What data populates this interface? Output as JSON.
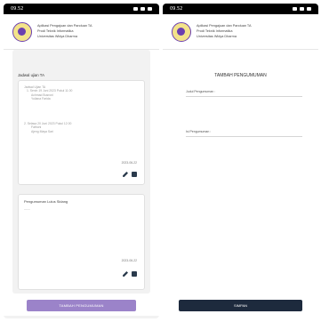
{
  "statusbar": {
    "time": "09.52"
  },
  "header": {
    "line1": "Aplikasi Pengajuan dan Panduan TA",
    "line2": "Prodi Teknik Informatika",
    "line3": "Universitas Widya Dharma"
  },
  "left": {
    "section_title": "Jadwal ujian TA",
    "card1": {
      "lines": [
        "Jadwal Ujian TA",
        "1. Senin 19 Juni 2023 Pukul 11.00",
        "Achmad Busroni",
        "Yuliana Farida",
        "2. Selasa 20 Juni 2023 Pukul 12.00",
        "Fathoni",
        "Ajeng Maya Sari"
      ],
      "date": "2023-06-22"
    },
    "card2": {
      "title": "Pengumuman Lulus Sidang",
      "subtitle": "------",
      "date": "2023-06-22"
    },
    "button_label": "TAMBAH PENGUMUMAN"
  },
  "right": {
    "form_title": "TAMBAH PENGUMUMAN",
    "field1_label": "Judul Pengumuman :",
    "field2_label": "Isi Pengumuman :",
    "button_label": "SIMPAN"
  }
}
